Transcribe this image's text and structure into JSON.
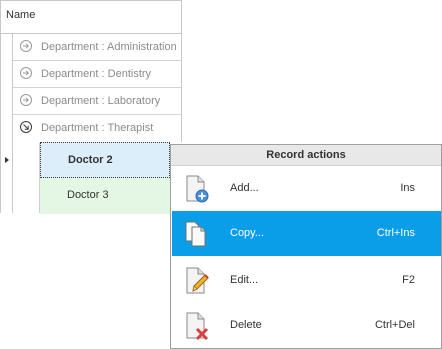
{
  "grid": {
    "column_header": "Name",
    "groups": [
      {
        "label": "Department : Administration",
        "state": "collapsed"
      },
      {
        "label": "Department : Dentistry",
        "state": "collapsed"
      },
      {
        "label": "Department : Laboratory",
        "state": "collapsed"
      },
      {
        "label": "Department : Therapist",
        "state": "expanded"
      }
    ],
    "rows": [
      {
        "label": "Doctor 2",
        "selected": true
      },
      {
        "label": "Doctor 3",
        "selected": false
      }
    ]
  },
  "context_menu": {
    "title": "Record actions",
    "items": [
      {
        "label": "Add...",
        "shortcut": "Ins",
        "icon": "add-document-icon"
      },
      {
        "label": "Copy...",
        "shortcut": "Ctrl+Ins",
        "icon": "copy-document-icon",
        "highlighted": true
      },
      {
        "label": "Edit...",
        "shortcut": "F2",
        "icon": "edit-document-icon"
      },
      {
        "label": "Delete",
        "shortcut": "Ctrl+Del",
        "icon": "delete-document-icon"
      }
    ]
  },
  "colors": {
    "highlight": "#0a9ee8",
    "selected_row": "#dbeefa",
    "other_row": "#e4f7e4"
  }
}
